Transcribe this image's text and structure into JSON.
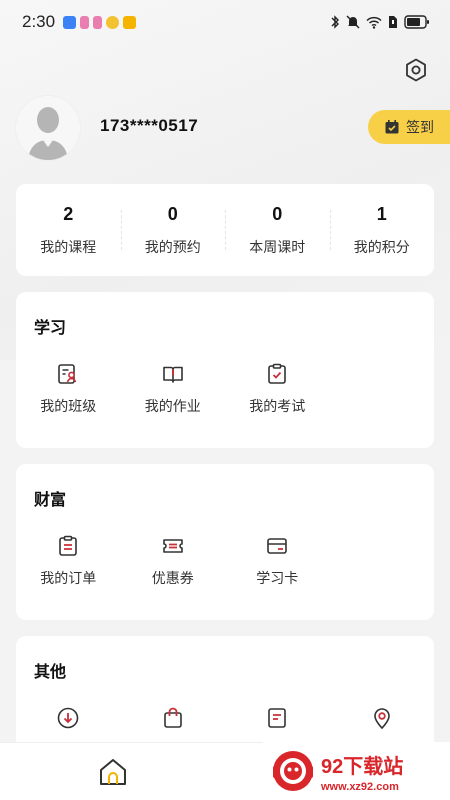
{
  "status_bar": {
    "time": "2:30",
    "app_icons": [
      "vpn-shield-icon",
      "pink-app-icon",
      "pink-app-icon",
      "weibo-icon",
      "yellow-app-icon"
    ],
    "right_icons": [
      "bluetooth-icon",
      "mute-icon",
      "wifi-icon",
      "sim-icon",
      "battery-icon"
    ]
  },
  "header": {
    "settings_icon": "gear-icon"
  },
  "profile": {
    "phone": "173****0517",
    "signin_label": "签到",
    "signin_icon": "calendar-check-icon"
  },
  "stats": [
    {
      "value": "2",
      "label": "我的课程"
    },
    {
      "value": "0",
      "label": "我的预约"
    },
    {
      "value": "0",
      "label": "本周课时"
    },
    {
      "value": "1",
      "label": "我的积分"
    }
  ],
  "learn": {
    "title": "学习",
    "items": [
      {
        "label": "我的班级",
        "icon": "class-roster-icon"
      },
      {
        "label": "我的作业",
        "icon": "homework-book-icon"
      },
      {
        "label": "我的考试",
        "icon": "exam-clipboard-icon"
      }
    ]
  },
  "wealth": {
    "title": "财富",
    "items": [
      {
        "label": "我的订单",
        "icon": "order-list-icon"
      },
      {
        "label": "优惠券",
        "icon": "coupon-icon"
      },
      {
        "label": "学习卡",
        "icon": "study-card-icon"
      }
    ]
  },
  "other": {
    "title": "其他",
    "items": [
      {
        "icon": "download-icon"
      },
      {
        "icon": "shopping-bag-icon"
      },
      {
        "icon": "notes-icon"
      },
      {
        "icon": "location-pin-icon"
      }
    ]
  },
  "bottom_nav": {
    "home_icon": "home-icon"
  },
  "watermark": {
    "title": "92下载站",
    "url": "www.xz92.com"
  },
  "colors": {
    "accent_red": "#c8303a",
    "signin_yellow": "#f8d047",
    "watermark_red": "#d8262b"
  }
}
